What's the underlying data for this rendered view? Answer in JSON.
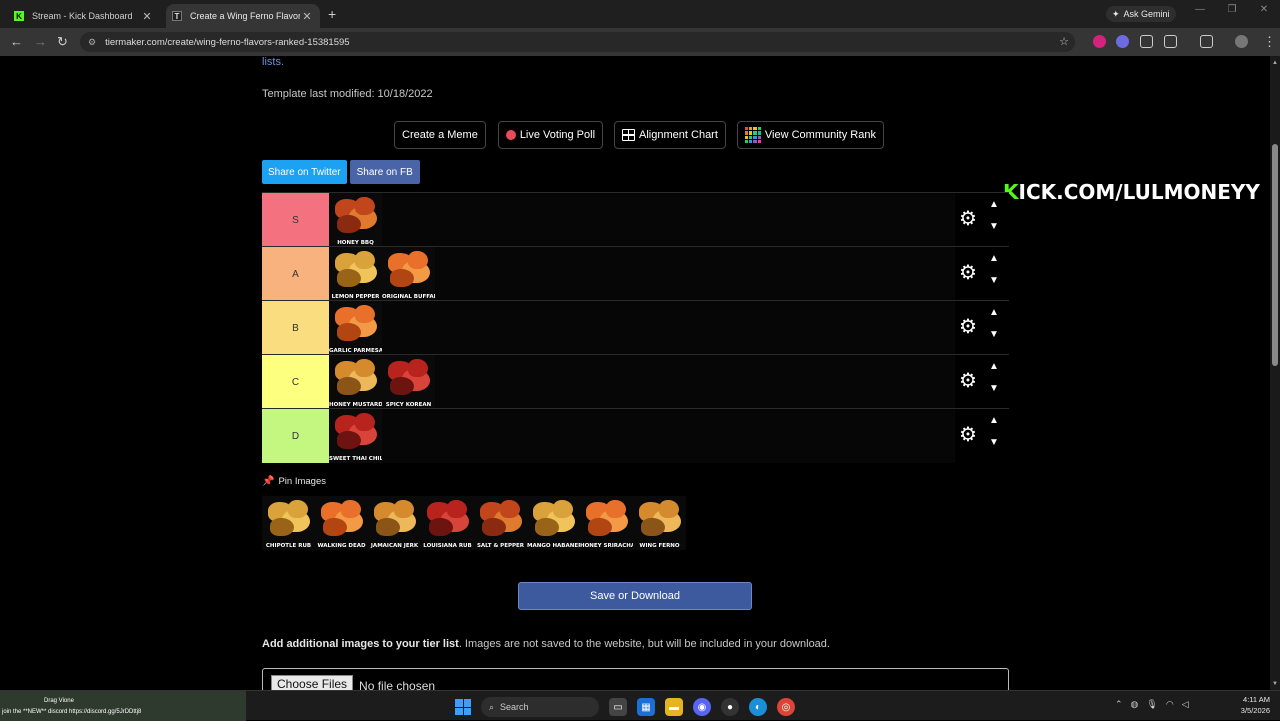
{
  "browser": {
    "tabs": [
      {
        "title": "Stream - Kick Dashboard",
        "favicon": "K"
      },
      {
        "title": "Create a Wing Ferno Flavors Ti",
        "favicon": "T"
      }
    ],
    "ask_gemini": "Ask Gemini",
    "url": "tiermaker.com/create/wing-ferno-flavors-ranked-15381595"
  },
  "page": {
    "lists_link": "lists.",
    "template_modified": "Template last modified: 10/18/2022",
    "actions": {
      "create_meme": "Create a Meme",
      "live_voting": "Live Voting Poll",
      "alignment_chart": "Alignment Chart",
      "community_rank": "View Community Rank"
    },
    "share": {
      "twitter": "Share on Twitter",
      "facebook": "Share on FB"
    },
    "overlay": {
      "k": "K",
      "rest": "ICK.COM/LULMONEYY"
    },
    "tiers": [
      {
        "label": "S",
        "color": "#f4727f",
        "items": [
          "HONEY BBQ"
        ]
      },
      {
        "label": "A",
        "color": "#f8b27e",
        "items": [
          "LEMON PEPPER",
          "ORIGINAL BUFFALO"
        ]
      },
      {
        "label": "B",
        "color": "#f9dd7f",
        "items": [
          "GARLIC PARMESAN"
        ]
      },
      {
        "label": "C",
        "color": "#fdff7f",
        "items": [
          "HONEY MUSTARD",
          "SPICY KOREAN"
        ]
      },
      {
        "label": "D",
        "color": "#c4f77f",
        "items": [
          "SWEET THAI CHILI"
        ]
      }
    ],
    "pin_images": "Pin Images",
    "pool": [
      "CHIPOTLE RUB",
      "WALKING DEAD",
      "JAMAICAN JERK",
      "LOUISIANA RUB",
      "SALT & PEPPER",
      "MANGO HABANERO",
      "HONEY SRIRACHA",
      "WING FERNO"
    ],
    "save_button": "Save or Download",
    "add_images_bold": "Add additional images to your tier list",
    "add_images_rest": ". Images are not saved to the website, but will be included in your download.",
    "choose_files": "Choose Files",
    "no_file": "No file chosen"
  },
  "taskbar": {
    "overlay_line1": "Drag Vione",
    "overlay_line2": "join the **NEW** discord https://discord.gg/5JrDDttj8",
    "search": "Search",
    "time": "4:11 AM",
    "date": "3/5/2026"
  }
}
